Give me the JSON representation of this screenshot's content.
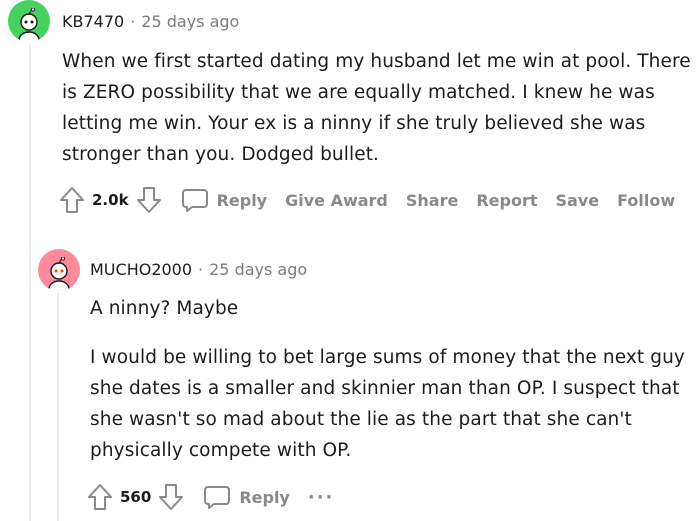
{
  "comments": [
    {
      "username": "KB7470",
      "separator": "·",
      "timestamp": "25 days ago",
      "avatar_color": "#46d160",
      "paragraphs": [
        "When we first started dating my husband let me win at pool. There is ZERO possibility that we are equally matched. I knew he was letting me win. Your ex is a ninny if she truly believed she was stronger than you. Dodged bullet."
      ],
      "votes": "2.0k",
      "actions": {
        "reply": "Reply",
        "give_award": "Give Award",
        "share": "Share",
        "report": "Report",
        "save": "Save",
        "follow": "Follow"
      }
    },
    {
      "username": "MUCHO2000",
      "separator": "·",
      "timestamp": "25 days ago",
      "avatar_color": "#ff8a9b",
      "paragraphs": [
        "A ninny? Maybe",
        "I would be willing to bet large sums of money that the next guy she dates is a smaller and skinnier man than OP. I suspect that she wasn't so mad about the lie as the part that she can't physically compete with OP."
      ],
      "votes": "560",
      "actions": {
        "reply": "Reply",
        "more": "···"
      }
    }
  ],
  "icons": {
    "upvote": "upvote-arrow-icon",
    "downvote": "downvote-arrow-icon",
    "reply": "speech-bubble-icon",
    "avatar": "snoo-avatar-icon"
  },
  "colors": {
    "text": "#1c1c1c",
    "muted": "#7c7c7c",
    "action": "#878a8c",
    "thread_line": "#edeff1"
  }
}
